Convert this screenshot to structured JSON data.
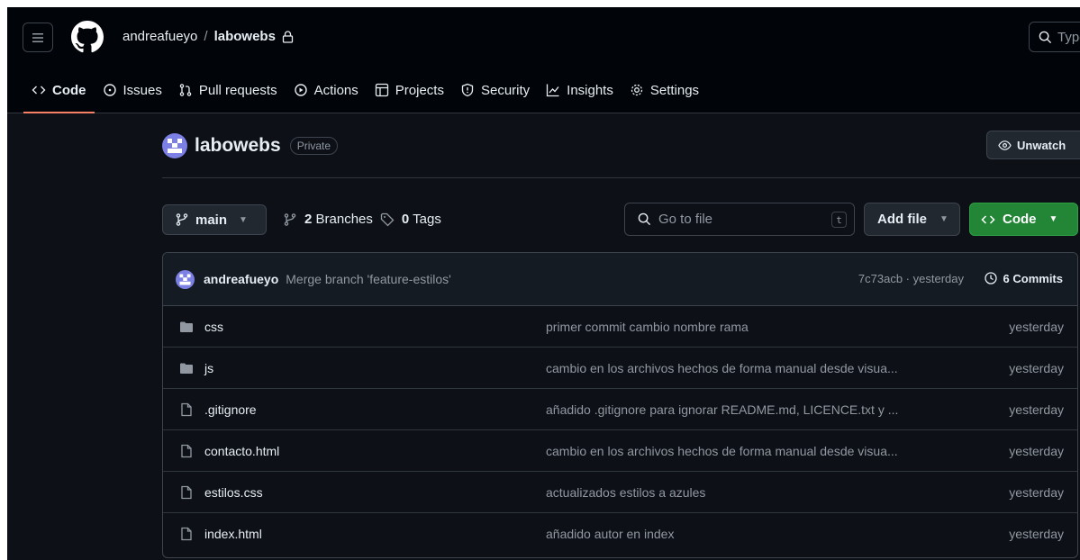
{
  "header": {
    "owner": "andreafueyo",
    "separator": "/",
    "repo": "labowebs",
    "search_placeholder": "Type"
  },
  "tabs": [
    {
      "label": "Code",
      "icon": "code-icon",
      "active": true
    },
    {
      "label": "Issues",
      "icon": "issue-icon"
    },
    {
      "label": "Pull requests",
      "icon": "pull-request-icon"
    },
    {
      "label": "Actions",
      "icon": "play-icon"
    },
    {
      "label": "Projects",
      "icon": "table-icon"
    },
    {
      "label": "Security",
      "icon": "shield-icon"
    },
    {
      "label": "Insights",
      "icon": "graph-icon"
    },
    {
      "label": "Settings",
      "icon": "gear-icon"
    }
  ],
  "repo": {
    "title": "labowebs",
    "visibility": "Private",
    "unwatch_label": "Unwatch"
  },
  "branch_bar": {
    "branch": "main",
    "branches_count": "2",
    "branches_label": "Branches",
    "tags_count": "0",
    "tags_label": "Tags",
    "goto_placeholder": "Go to file",
    "goto_shortcut": "t",
    "add_file_label": "Add file",
    "code_label": "Code"
  },
  "latest_commit": {
    "author": "andreafueyo",
    "message": "Merge branch 'feature-estilos'",
    "meta": "7c73acb · yesterday",
    "commits_label": "6 Commits"
  },
  "files": [
    {
      "name": "css",
      "type": "folder",
      "message": "primer commit cambio nombre rama",
      "date": "yesterday"
    },
    {
      "name": "js",
      "type": "folder",
      "message": "cambio en los archivos hechos de forma manual desde visua...",
      "date": "yesterday"
    },
    {
      "name": ".gitignore",
      "type": "file",
      "message": "añadido .gitignore para ignorar README.md, LICENCE.txt y ...",
      "date": "yesterday"
    },
    {
      "name": "contacto.html",
      "type": "file",
      "message": "cambio en los archivos hechos de forma manual desde visua...",
      "date": "yesterday"
    },
    {
      "name": "estilos.css",
      "type": "file",
      "message": "actualizados estilos a azules",
      "date": "yesterday"
    },
    {
      "name": "index.html",
      "type": "file",
      "message": "añadido autor en index",
      "date": "yesterday"
    }
  ],
  "colors": {
    "accent_green": "#238636",
    "active_tab_underline": "#f78166",
    "folder_icon": "#9198a1"
  }
}
